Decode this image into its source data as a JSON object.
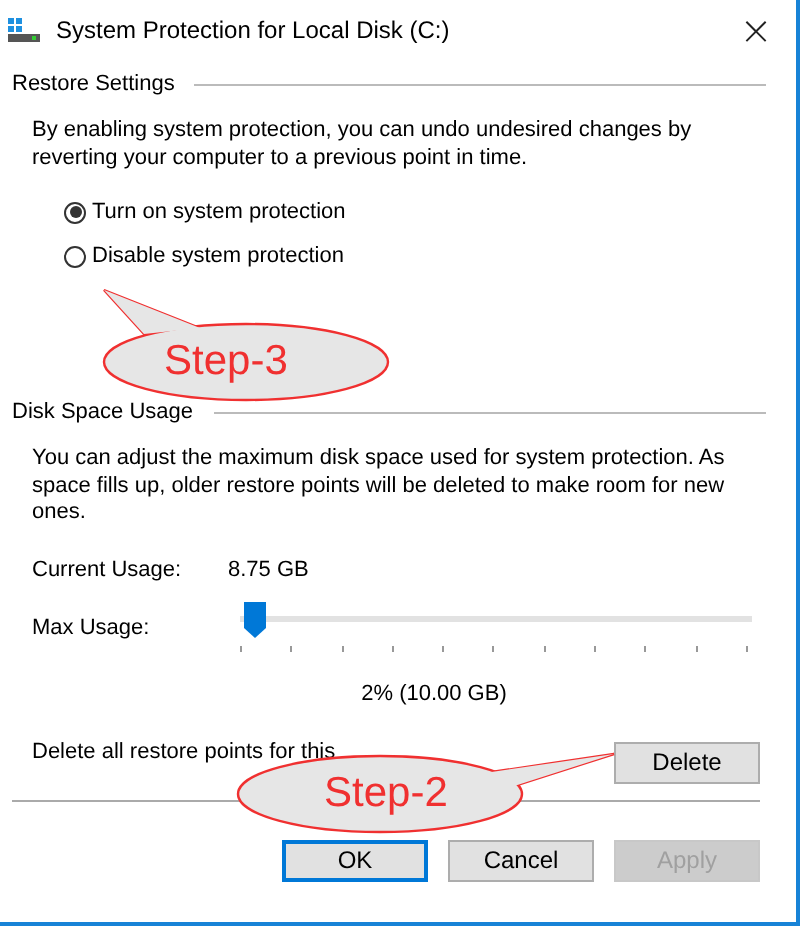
{
  "window": {
    "title": "System Protection for Local Disk (C:)",
    "close": "×"
  },
  "restore_settings": {
    "heading": "Restore Settings",
    "description": "By enabling system protection, you can undo undesired changes by reverting your computer to a previous point in time.",
    "options": [
      {
        "label": "Turn on system protection",
        "selected": true
      },
      {
        "label": "Disable system protection",
        "selected": false
      }
    ]
  },
  "disk_space_usage": {
    "heading": "Disk Space Usage",
    "description": "You can adjust the maximum disk space used for system protection. As space fills up, older restore points will be deleted to make room for new ones.",
    "current_usage_label": "Current Usage:",
    "current_usage_value": "8.75 GB",
    "max_usage_label": "Max Usage:",
    "max_usage": {
      "level": 0.01
    },
    "max_usage_reading": "2% (10.00 GB)",
    "delete_text": "Delete all restore points for this",
    "delete_button": "Delete"
  },
  "buttons": [
    {
      "label": "OK",
      "kind": "default"
    },
    {
      "label": "Cancel",
      "kind": "normal"
    },
    {
      "label": "Apply",
      "kind": "disabled"
    }
  ],
  "callouts": [
    {
      "label": "Step-3"
    },
    {
      "label": "Step-2"
    }
  ]
}
